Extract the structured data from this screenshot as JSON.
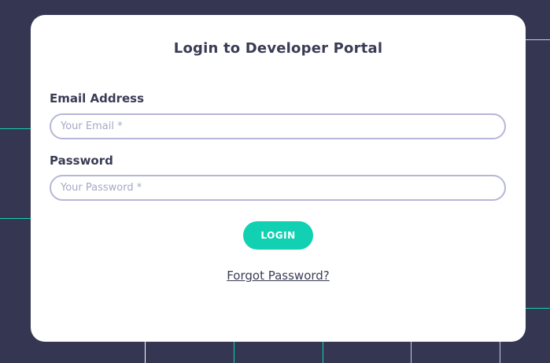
{
  "page": {
    "background_color": "#353752",
    "accent_color": "#12d1b2"
  },
  "login_card": {
    "title": "Login to Developer Portal",
    "email": {
      "label": "Email Address",
      "placeholder": "Your Email *",
      "value": ""
    },
    "password": {
      "label": "Password",
      "placeholder": "Your Password *",
      "value": ""
    },
    "login_button_label": "LOGIN",
    "forgot_password_label": "Forgot Password?"
  }
}
